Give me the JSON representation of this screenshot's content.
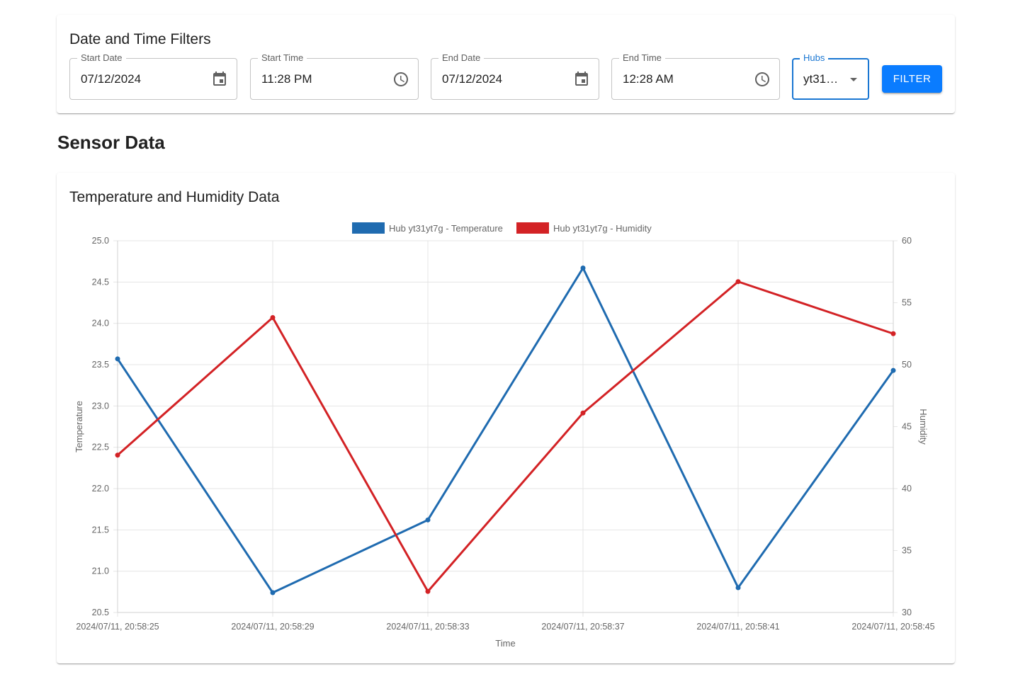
{
  "filters": {
    "title": "Date and Time Filters",
    "start_date": {
      "label": "Start Date",
      "value": "07/12/2024",
      "icon": "calendar-icon"
    },
    "start_time": {
      "label": "Start Time",
      "value": "11:28 PM",
      "icon": "clock-icon"
    },
    "end_date": {
      "label": "End Date",
      "value": "07/12/2024",
      "icon": "calendar-icon"
    },
    "end_time": {
      "label": "End Time",
      "value": "12:28 AM",
      "icon": "clock-icon"
    },
    "hubs": {
      "label": "Hubs",
      "value": "yt31…",
      "icon": "dropdown-arrow-icon"
    },
    "filter_button": "FILTER",
    "accent_color": "#1976d2",
    "button_color": "#0a7cff"
  },
  "section_heading": "Sensor Data",
  "chart_card": {
    "title": "Temperature and Humidity Data"
  },
  "chart_data": {
    "type": "line",
    "x": [
      "2024/07/11, 20:58:25",
      "2024/07/11, 20:58:29",
      "2024/07/11, 20:58:33",
      "2024/07/11, 20:58:37",
      "2024/07/11, 20:58:41",
      "2024/07/11, 20:58:45"
    ],
    "xlabel": "Time",
    "series": [
      {
        "name": "Hub yt31yt7g - Temperature",
        "axis": "left",
        "color": "#1f6bb0",
        "values": [
          23.57,
          20.74,
          21.62,
          24.67,
          20.8,
          23.43
        ]
      },
      {
        "name": "Hub yt31yt7g - Humidity",
        "axis": "right",
        "color": "#d32225",
        "values": [
          42.7,
          53.8,
          31.7,
          46.1,
          56.7,
          52.5
        ]
      }
    ],
    "y_left": {
      "label": "Temperature",
      "range": [
        20.5,
        25.0
      ],
      "ticks": [
        "25.0",
        "24.5",
        "24.0",
        "23.5",
        "23.0",
        "22.5",
        "22.0",
        "21.5",
        "21.0",
        "20.5"
      ]
    },
    "y_right": {
      "label": "Humidity",
      "range": [
        30,
        60
      ],
      "ticks": [
        "60",
        "55",
        "50",
        "45",
        "40",
        "35",
        "30"
      ]
    },
    "grid": true,
    "legend_position": "top-center"
  }
}
